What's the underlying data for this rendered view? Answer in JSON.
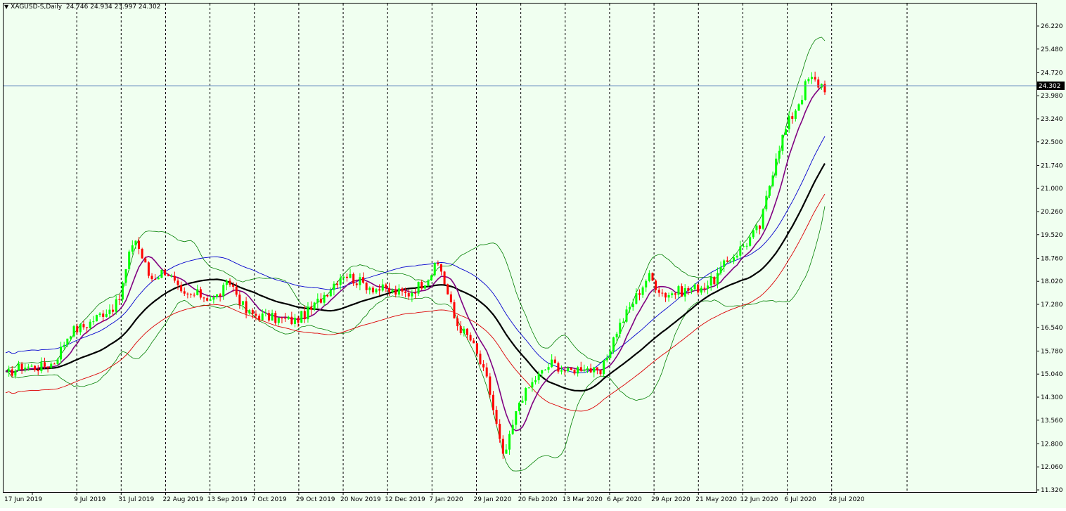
{
  "chart_title": {
    "symbol": "XAGUSD-S,Daily",
    "ohlc": "24.746 24.934 23.997 24.302"
  },
  "chart_data": {
    "type": "candlestick",
    "symbol": "XAGUSD-S",
    "timeframe": "Daily",
    "last_price": "24.302",
    "ylim": [
      11.32,
      26.22
    ],
    "y_ticks": [
      "26.220",
      "25.480",
      "24.720",
      "23.980",
      "23.240",
      "22.500",
      "21.740",
      "21.000",
      "20.260",
      "19.520",
      "18.760",
      "18.020",
      "17.280",
      "16.540",
      "15.780",
      "15.040",
      "14.300",
      "13.560",
      "12.800",
      "12.060",
      "11.320"
    ],
    "x_labels": [
      "17 Jun 2019",
      "9 Jul 2019",
      "31 Jul 2019",
      "22 Aug 2019",
      "13 Sep 2019",
      "7 Oct 2019",
      "29 Oct 2019",
      "20 Nov 2019",
      "12 Dec 2019",
      "7 Jan 2020",
      "29 Jan 2020",
      "20 Feb 2020",
      "13 Mar 2020",
      "6 Apr 2020",
      "29 Apr 2020",
      "21 May 2020",
      "12 Jun 2020",
      "6 Jul 2020",
      "28 Jul 2020"
    ],
    "price_anchors": [
      15.0,
      15.3,
      15.25,
      15.4,
      16.4,
      16.6,
      17.0,
      17.3,
      19.5,
      18.1,
      18.4,
      17.5,
      17.6,
      17.45,
      18.0,
      17.0,
      16.9,
      16.8,
      16.75,
      17.1,
      17.7,
      18.3,
      18.0,
      17.8,
      17.7,
      17.6,
      18.0,
      18.6,
      16.7,
      16.1,
      14.8,
      12.3,
      14.2,
      14.9,
      15.4,
      15.1,
      15.3,
      15.0,
      16.4,
      17.3,
      18.2,
      17.6,
      17.7,
      17.8,
      18.0,
      18.7,
      19.2,
      19.8,
      22.2,
      23.4,
      24.5,
      24.3
    ],
    "colors": {
      "background": "#f0fff0",
      "bull_candle": "#00ff00",
      "bear_candle": "#ff0000",
      "bollinger": "#008000",
      "ma_fast": "#800080",
      "ma_mid": "#000000",
      "ma_upper": "#0000cd",
      "ma_lower": "#dc0000",
      "price_line": "#6a8fbf",
      "grid": "#000000"
    }
  }
}
